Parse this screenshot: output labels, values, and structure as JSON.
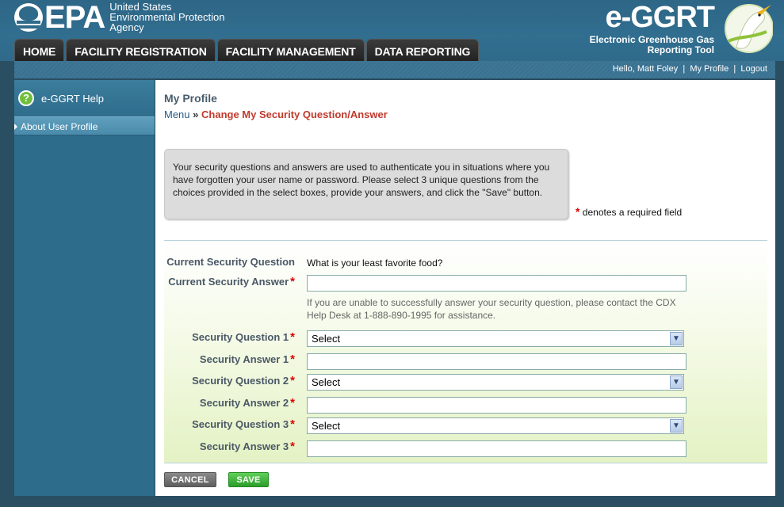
{
  "header": {
    "epa_letters": "EPA",
    "agency_lines": [
      "United States",
      "Environmental Protection",
      "Agency"
    ],
    "brand_title": "e-GGRT",
    "brand_subtitle_lines": [
      "Electronic Greenhouse Gas",
      "Reporting Tool"
    ],
    "nav": [
      "HOME",
      "FACILITY REGISTRATION",
      "FACILITY MANAGEMENT",
      "DATA REPORTING"
    ]
  },
  "userbar": {
    "greeting": "Hello, Matt Foley",
    "profile": "My Profile",
    "logout": "Logout",
    "separator": "|"
  },
  "sidebar": {
    "help_title": "e-GGRT Help",
    "items": [
      "About User Profile"
    ]
  },
  "main": {
    "title": "My Profile",
    "breadcrumb_menu": "Menu",
    "breadcrumb_sep": "»",
    "breadcrumb_current": "Change My Security Question/Answer",
    "info": "Your security questions and answers are used to authenticate you in situations where you have forgotten your user name or password. Please select 3 unique questions from the choices provided in the select boxes, provide your answers, and click the \"Save\" button.",
    "required_note": "denotes a required field",
    "current_question_label": "Current Security Question",
    "current_question_value": "What is your least favorite food?",
    "current_answer_label": "Current Security Answer",
    "current_answer_value": "",
    "hint": "If you are unable to successfully answer your security question, please contact the CDX Help Desk at 1-888-890-1995 for assistance.",
    "q1_label": "Security Question 1",
    "q1_value": "Select",
    "a1_label": "Security Answer 1",
    "q2_label": "Security Question 2",
    "q2_value": "Select",
    "a2_label": "Security Answer 2",
    "q3_label": "Security Question 3",
    "q3_value": "Select",
    "a3_label": "Security Answer 3",
    "cancel": "CANCEL",
    "save": "SAVE"
  },
  "colors": {
    "header_blue": "#316e8f",
    "breadcrumb_red": "#c0392b",
    "save_green": "#2c9c2a",
    "required_red": "#dd0000"
  }
}
